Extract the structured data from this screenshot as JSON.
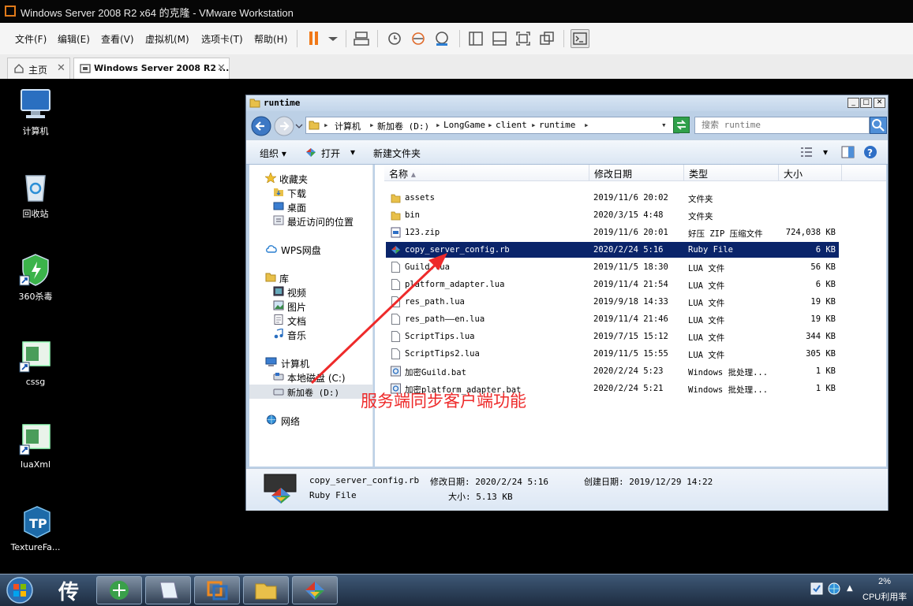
{
  "window": {
    "title": "Windows Server 2008 R2 x64 的克隆 - VMware Workstation"
  },
  "menu": [
    "文件(F)",
    "编辑(E)",
    "查看(V)",
    "虚拟机(M)",
    "选项卡(T)",
    "帮助(H)"
  ],
  "tabs": [
    {
      "label": "主页"
    },
    {
      "label": "Windows Server 2008 R2 ..."
    }
  ],
  "desktop_icons": [
    {
      "label": "计算机",
      "icon": "computer-icon"
    },
    {
      "label": "回收站",
      "icon": "recycle-bin-icon"
    },
    {
      "label": "360杀毒",
      "icon": "shield-icon"
    },
    {
      "label": "cssg",
      "icon": "app-window-icon"
    },
    {
      "label": "luaXml",
      "icon": "app-window-icon"
    },
    {
      "label": "TextureFa...",
      "icon": "texturepacker-icon"
    }
  ],
  "explorer": {
    "title": "runtime",
    "breadcrumb": [
      "计算机",
      "新加卷 (D:)",
      "LongGame",
      "client",
      "runtime"
    ],
    "search_placeholder": "搜索 runtime",
    "commands": {
      "organize": "组织",
      "open": "打开",
      "new_folder": "新建文件夹"
    },
    "nav": {
      "favorites": "收藏夹",
      "fav_items": [
        "下载",
        "桌面",
        "最近访问的位置"
      ],
      "wps": "WPS网盘",
      "library": "库",
      "lib_items": [
        "视频",
        "图片",
        "文档",
        "音乐"
      ],
      "computer": "计算机",
      "drives": [
        "本地磁盘 (C:)",
        "新加卷 (D:)"
      ],
      "network": "网络"
    },
    "columns": [
      "名称",
      "修改日期",
      "类型",
      "大小"
    ],
    "files": [
      {
        "name": "assets",
        "date": "2019/11/6 20:02",
        "type": "文件夹",
        "size": "",
        "icon": "folder-icon"
      },
      {
        "name": "bin",
        "date": "2020/3/15 4:48",
        "type": "文件夹",
        "size": "",
        "icon": "folder-icon"
      },
      {
        "name": "123.zip",
        "date": "2019/11/6 20:01",
        "type": "好压 ZIP 压缩文件",
        "size": "724,038 KB",
        "icon": "zip-icon"
      },
      {
        "name": "copy_server_config.rb",
        "date": "2020/2/24 5:16",
        "type": "Ruby File",
        "size": "6 KB",
        "icon": "ruby-icon",
        "selected": true
      },
      {
        "name": "Guild.lua",
        "date": "2019/11/5 18:30",
        "type": "LUA 文件",
        "size": "56 KB",
        "icon": "file-icon"
      },
      {
        "name": "platform_adapter.lua",
        "date": "2019/11/4 21:54",
        "type": "LUA 文件",
        "size": "6 KB",
        "icon": "file-icon"
      },
      {
        "name": "res_path.lua",
        "date": "2019/9/18 14:33",
        "type": "LUA 文件",
        "size": "19 KB",
        "icon": "file-icon"
      },
      {
        "name": "res_path——en.lua",
        "date": "2019/11/4 21:46",
        "type": "LUA 文件",
        "size": "19 KB",
        "icon": "file-icon"
      },
      {
        "name": "ScriptTips.lua",
        "date": "2019/7/15 15:12",
        "type": "LUA 文件",
        "size": "344 KB",
        "icon": "file-icon"
      },
      {
        "name": "ScriptTips2.lua",
        "date": "2019/11/5 15:55",
        "type": "LUA 文件",
        "size": "305 KB",
        "icon": "file-icon"
      },
      {
        "name": "加密Guild.bat",
        "date": "2020/2/24 5:23",
        "type": "Windows 批处理...",
        "size": "1 KB",
        "icon": "bat-icon"
      },
      {
        "name": "加密platform_adapter.bat",
        "date": "2020/2/24 5:21",
        "type": "Windows 批处理...",
        "size": "1 KB",
        "icon": "bat-icon"
      }
    ],
    "details": {
      "name": "copy_server_config.rb",
      "modified": "修改日期: 2020/2/24 5:16",
      "created": "创建日期: 2019/12/29 14:22",
      "type": "Ruby File",
      "size": "大小: 5.13 KB"
    }
  },
  "annotation": {
    "text": "服务端同步客户端功能",
    "color": "#ee2a2a"
  },
  "taskbar": {
    "cpu_percent": "2%",
    "cpu_label": "CPU利用率"
  }
}
